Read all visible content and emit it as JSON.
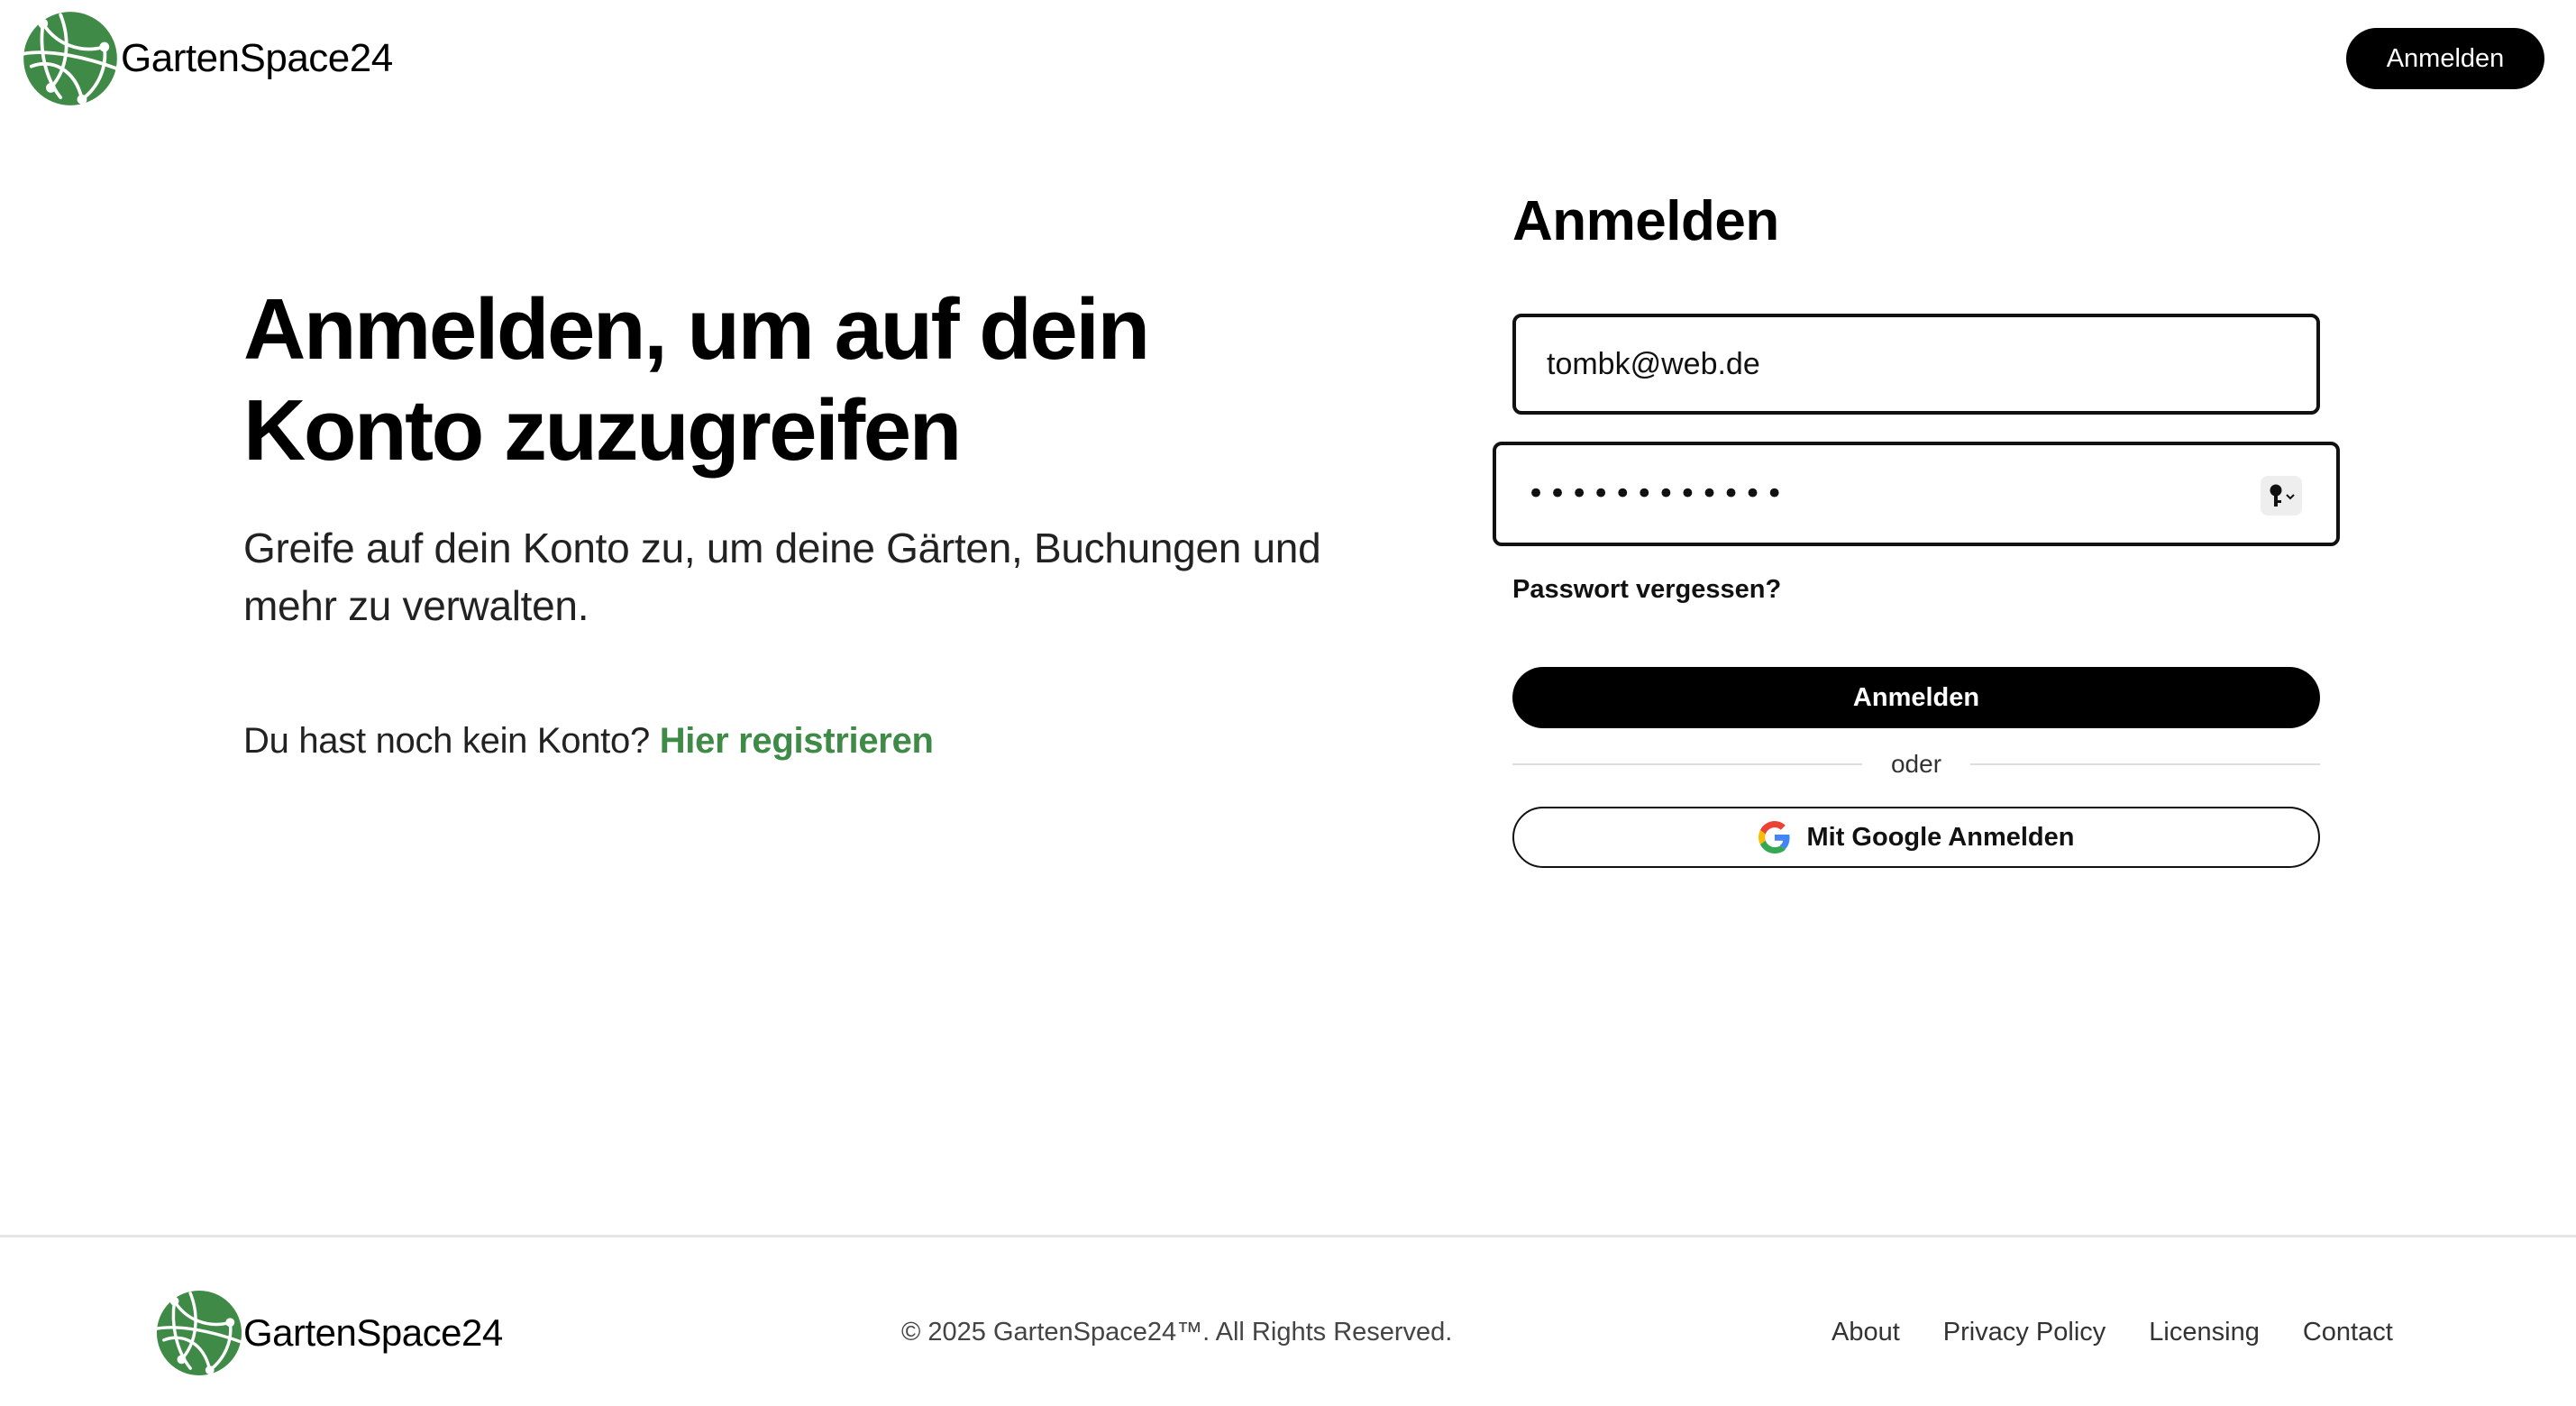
{
  "header": {
    "brand": "GartenSpace24",
    "login_button": "Anmelden"
  },
  "hero": {
    "title": "Anmelden, um auf dein Konto zuzugreifen",
    "subtitle": "Greife auf dein Konto zu, um deine Gärten, Buchungen und mehr zu verwalten.",
    "register_prompt": "Du hast noch kein Konto?",
    "register_link": "Hier registrieren"
  },
  "form": {
    "title": "Anmelden",
    "email_value": "tombk@web.de",
    "password_masked": "••••••••••••",
    "forgot_password": "Passwort vergessen?",
    "submit_label": "Anmelden",
    "divider_text": "oder",
    "google_label": "Mit Google Anmelden"
  },
  "footer": {
    "brand": "GartenSpace24",
    "copyright": "© 2025 GartenSpace24™. All Rights Reserved.",
    "links": [
      "About",
      "Privacy Policy",
      "Licensing",
      "Contact"
    ]
  },
  "colors": {
    "brand_green": "#3f8a46",
    "primary": "#000000"
  },
  "icons": [
    "globe-logo-icon",
    "key-icon",
    "google-icon"
  ]
}
